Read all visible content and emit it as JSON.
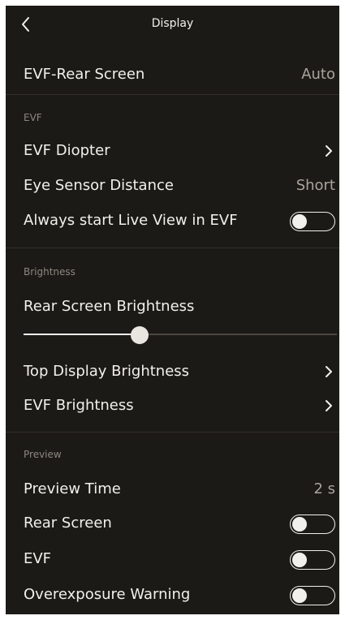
{
  "header": {
    "title": "Display"
  },
  "rows": {
    "evf_rear_screen": {
      "label": "EVF-Rear Screen",
      "value": "Auto"
    },
    "evf_diopter": {
      "label": "EVF Diopter"
    },
    "eye_sensor_distance": {
      "label": "Eye Sensor Distance",
      "value": "Short"
    },
    "always_start_live_view": {
      "label": "Always start Live View in EVF",
      "toggle": false
    },
    "rear_screen_brightness": {
      "label": "Rear Screen Brightness",
      "level": 0.37
    },
    "top_display_brightness": {
      "label": "Top Display Brightness"
    },
    "evf_brightness": {
      "label": "EVF Brightness"
    },
    "preview_time": {
      "label": "Preview Time",
      "value": "2 s"
    },
    "rear_screen": {
      "label": "Rear Screen",
      "toggle": false
    },
    "evf": {
      "label": "EVF",
      "toggle": false
    },
    "overexposure_warning": {
      "label": "Overexposure Warning",
      "toggle": false
    }
  },
  "sections": {
    "evf": "EVF",
    "brightness": "Brightness",
    "preview": "Preview"
  },
  "icons": {
    "back": "chevron-left-icon",
    "row_arrow": "chevron-right-icon"
  },
  "colors": {
    "background": "#1c1a17",
    "text": "#f2f0ec",
    "secondary": "#a9a49c"
  }
}
